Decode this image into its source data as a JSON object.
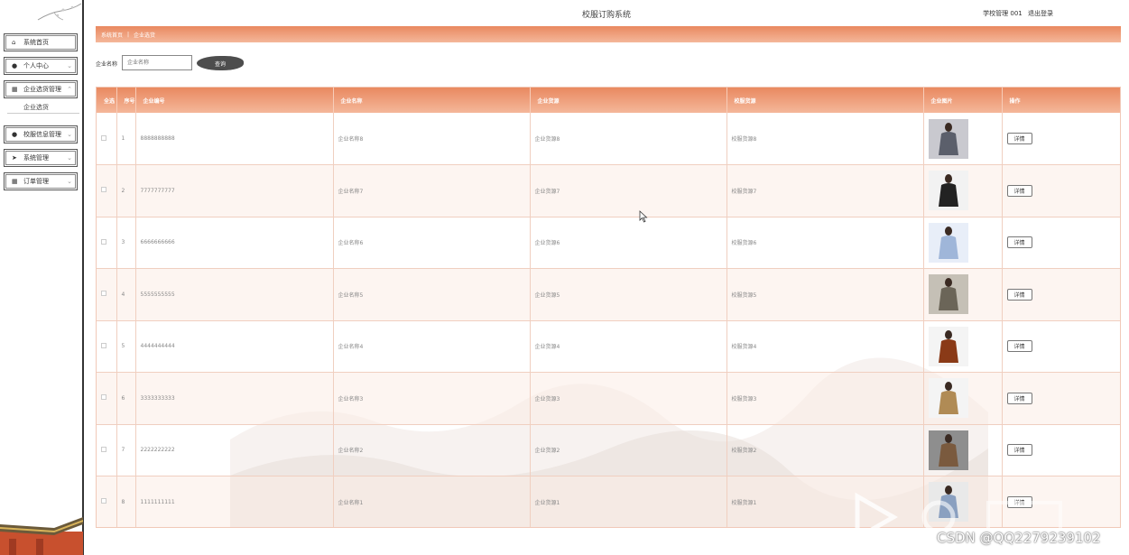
{
  "header": {
    "system_title": "校服订购系统",
    "user_name": "学校管理 001",
    "logout": "退出登录"
  },
  "sidebar": {
    "items": [
      {
        "label": "系统首页",
        "icon": "home-icon"
      },
      {
        "label": "个人中心",
        "icon": "user-icon"
      },
      {
        "label": "企业选货管理",
        "icon": "grid-icon"
      },
      {
        "label": "校服信息管理",
        "icon": "user-icon"
      },
      {
        "label": "系统管理",
        "icon": "send-icon"
      },
      {
        "label": "订单管理",
        "icon": "grid-icon"
      }
    ],
    "submenu_label": "企业选货"
  },
  "breadcrumb": {
    "home": "系统首页",
    "separator": "|",
    "current": "企业选货"
  },
  "search": {
    "label": "企业名称",
    "placeholder": "企业名称",
    "button": "查询"
  },
  "table": {
    "headers": [
      "全选",
      "序号",
      "企业编号",
      "企业名称",
      "企业货源",
      "校服货源",
      "企业图片",
      "操作"
    ],
    "detail_label": "详情",
    "rows": [
      {
        "index": "1",
        "code": "8888888888",
        "name": "企业名称8",
        "source": "企业货源8",
        "uniform": "校服货源8"
      },
      {
        "index": "2",
        "code": "7777777777",
        "name": "企业名称7",
        "source": "企业货源7",
        "uniform": "校服货源7"
      },
      {
        "index": "3",
        "code": "6666666666",
        "name": "企业名称6",
        "source": "企业货源6",
        "uniform": "校服货源6"
      },
      {
        "index": "4",
        "code": "5555555555",
        "name": "企业名称5",
        "source": "企业货源5",
        "uniform": "校服货源5"
      },
      {
        "index": "5",
        "code": "4444444444",
        "name": "企业名称4",
        "source": "企业货源4",
        "uniform": "校服货源4"
      },
      {
        "index": "6",
        "code": "3333333333",
        "name": "企业名称3",
        "source": "企业货源3",
        "uniform": "校服货源3"
      },
      {
        "index": "7",
        "code": "2222222222",
        "name": "企业名称2",
        "source": "企业货源2",
        "uniform": "校服货源2"
      },
      {
        "index": "8",
        "code": "1111111111",
        "name": "企业名称1",
        "source": "企业货源1",
        "uniform": "校服货源1"
      }
    ]
  },
  "watermark": {
    "csdn": "CSDN @QQ2279239102"
  },
  "colors": {
    "accent": "#e98960",
    "accent_light": "#f4b79a",
    "row_alt": "#fbece6"
  }
}
